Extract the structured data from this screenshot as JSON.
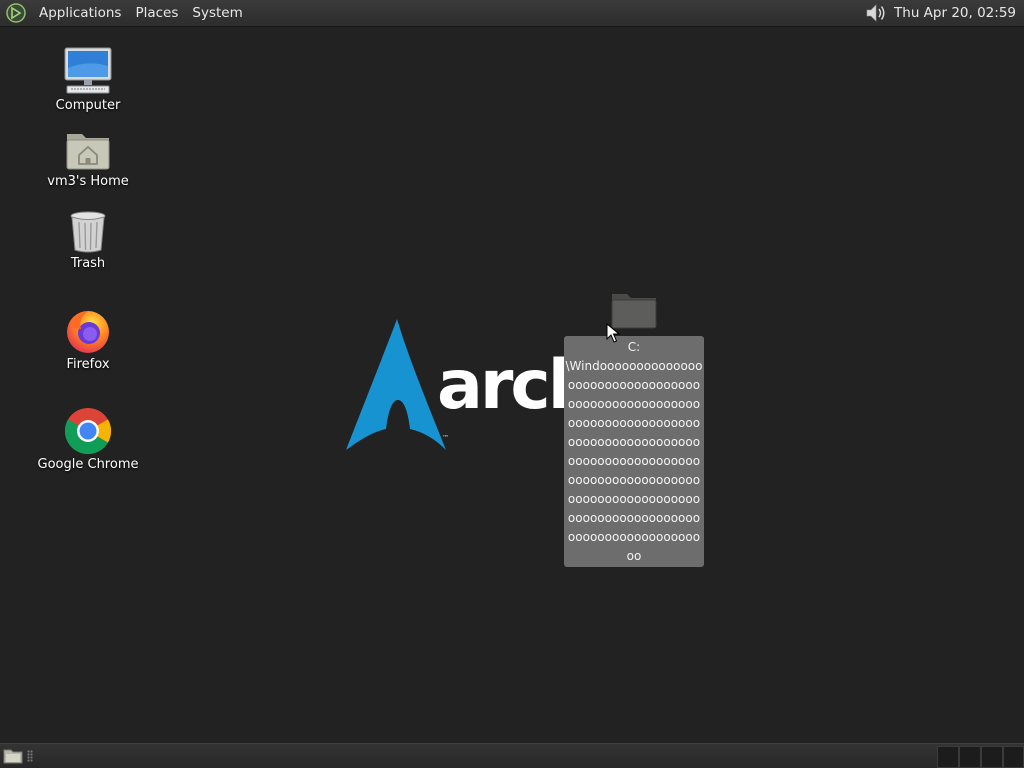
{
  "top_panel": {
    "menus": [
      "Applications",
      "Places",
      "System"
    ],
    "clock": "Thu Apr 20, 02:59"
  },
  "desktop_icons": [
    {
      "label": "Computer",
      "icon": "computer-icon"
    },
    {
      "label": "vm3's Home",
      "icon": "home-folder-icon"
    },
    {
      "label": "Trash",
      "icon": "trash-icon"
    },
    {
      "label": "Firefox",
      "icon": "firefox-icon"
    },
    {
      "label": "Google Chrome",
      "icon": "chrome-icon"
    }
  ],
  "wallpaper": {
    "logo_text": "arch",
    "trademark": "™",
    "accent": "#1793d1"
  },
  "folder_tooltip": {
    "lines": [
      "C:",
      "\\Windoooooooooooooo",
      "oooooooooooooooooo",
      "oooooooooooooooooo",
      "oooooooooooooooooo",
      "oooooooooooooooooo",
      "oooooooooooooooooo",
      "oooooooooooooooooo",
      "oooooooooooooooooo",
      "oooooooooooooooooo",
      "oooooooooooooooooo",
      "oo"
    ]
  }
}
